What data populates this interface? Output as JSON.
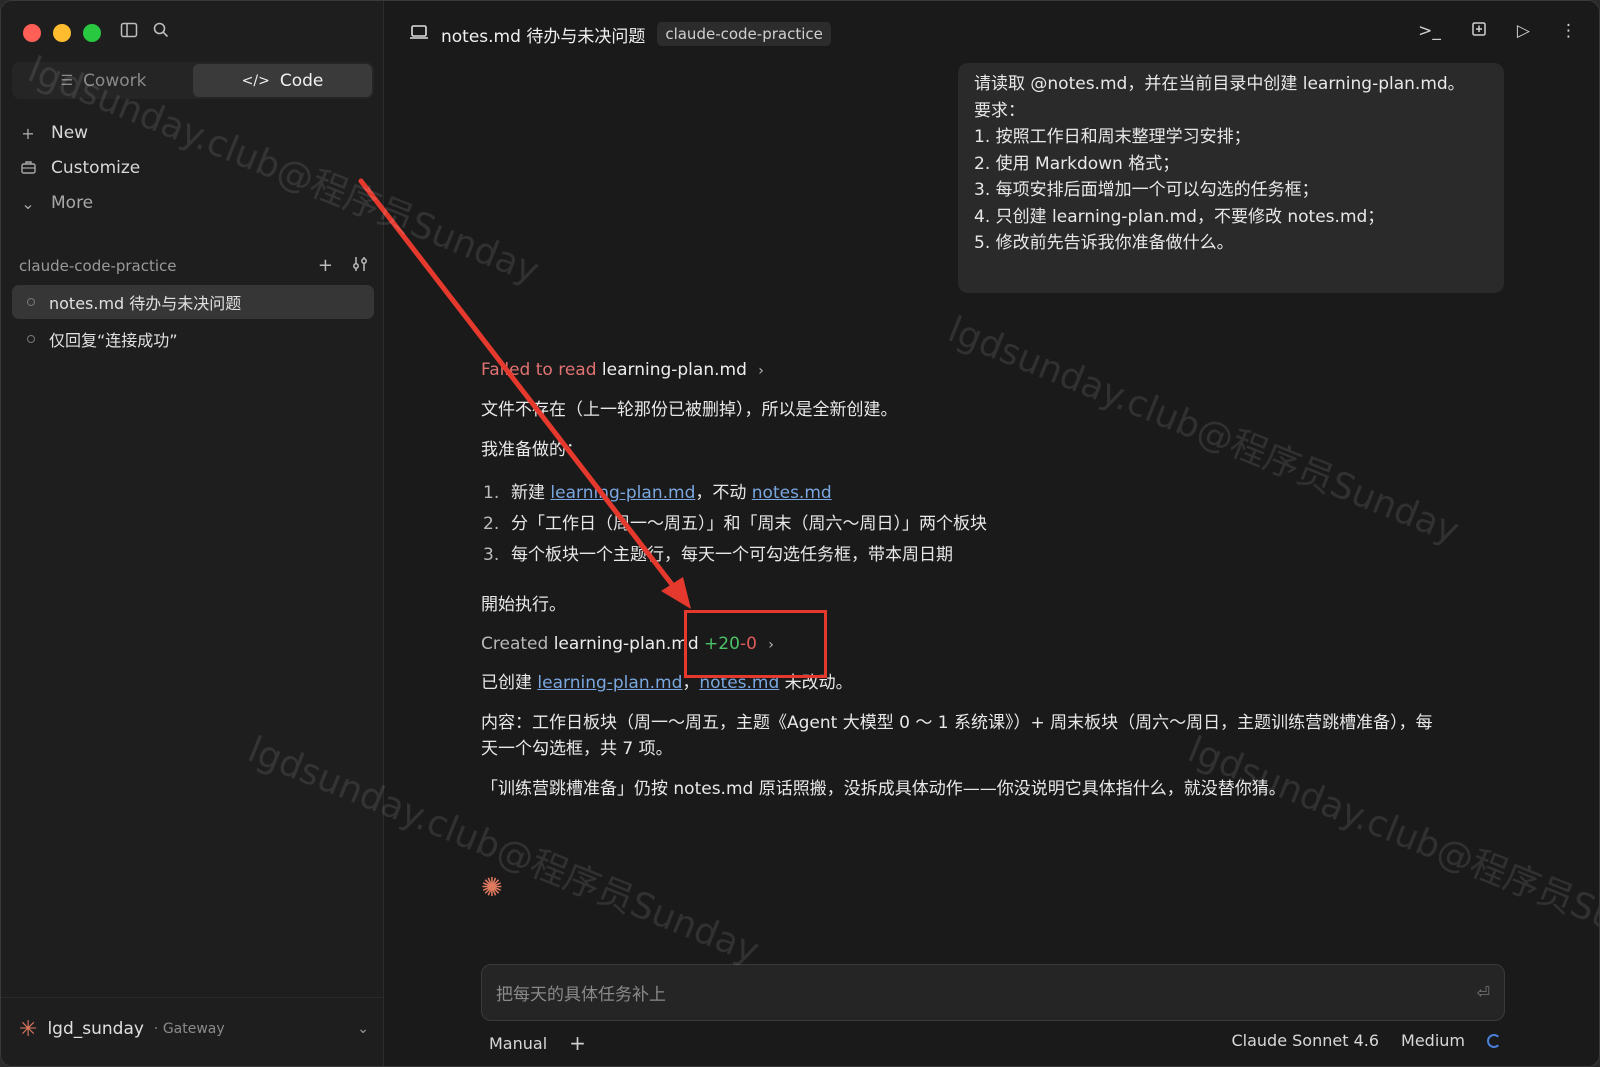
{
  "window": {
    "sidebar": {
      "modes": [
        {
          "label": "Cowork",
          "icon": "list-icon"
        },
        {
          "label": "Code",
          "icon": "code-icon"
        }
      ],
      "nav": [
        {
          "label": "New",
          "icon": "plus-icon"
        },
        {
          "label": "Customize",
          "icon": "briefcase-icon"
        },
        {
          "label": "More",
          "icon": "chevron-down-icon"
        }
      ],
      "project": "claude-code-practice",
      "sessions": [
        {
          "label": "notes.md 待办与未决问题",
          "active": true
        },
        {
          "label": "仅回复“连接成功”",
          "active": false
        }
      ],
      "user": {
        "name": "lgd_sunday",
        "gateway": "· Gateway"
      }
    },
    "titlebar": {
      "title": "notes.md 待办与未决问题",
      "badge": "claude-code-practice"
    },
    "conversation": {
      "user_message": [
        "请读取 @notes.md，并在当前目录中创建 learning-plan.md。",
        "要求：",
        "",
        "1. 按照工作日和周末整理学习安排；",
        "2. 使用 Markdown 格式；",
        "3. 每项安排后面增加一个可以勾选的任务框；",
        "4. 只创建 learning-plan.md，不要修改 notes.md；",
        "5. 修改前先告诉我你准备做什么。"
      ],
      "tool_read": {
        "error": "Failed to read",
        "file": "learning-plan.md"
      },
      "line_not_exist": "文件不存在（上一轮那份已被删掉），所以是全新创建。",
      "plan_intro": "我准备做的：",
      "steps": [
        {
          "n": "1.",
          "pre": "新建 ",
          "link1": "learning-plan.md",
          "mid": "，不动 ",
          "link2": "notes.md"
        },
        {
          "n": "2.",
          "text": "分「工作日（周一～周五）」和「周末（周六～周日）」两个板块"
        },
        {
          "n": "3.",
          "text": "每个板块一个主题行，每天一个可勾选任务框，带本周日期"
        }
      ],
      "start": "開始执行。",
      "tool_created": {
        "label": "Created",
        "file": "learning-plan.md",
        "added": "+20",
        "removed": "-0"
      },
      "done": {
        "pre": "已创建 ",
        "link1": "learning-plan.md",
        "sep": "，",
        "link2": "notes.md",
        "post": " 未改动。"
      },
      "content_line1": "内容：工作日板块（周一～周五，主题《Agent 大模型 0 ～ 1 系统课》）+ 周末板块（周六～周日，主题训练营跳槽准备），每",
      "content_line2": "天一个勾选框，共 7 项。",
      "note": "「训练营跳槽准备」仍按 notes.md 原话照搬，没拆成具体动作——你没说明它具体指什么，就没替你猜。"
    },
    "composer": {
      "placeholder": "把每天的具体任务补上"
    },
    "footer": {
      "mode": "Manual",
      "model": "Claude Sonnet 4.6",
      "effort": "Medium"
    },
    "watermark": "lgdsunday.club@程序员Sunday",
    "colors": {
      "annotation": "#e5392d",
      "added": "#4cc267",
      "removed": "#e05c5c",
      "link": "#7aa7e0"
    }
  }
}
